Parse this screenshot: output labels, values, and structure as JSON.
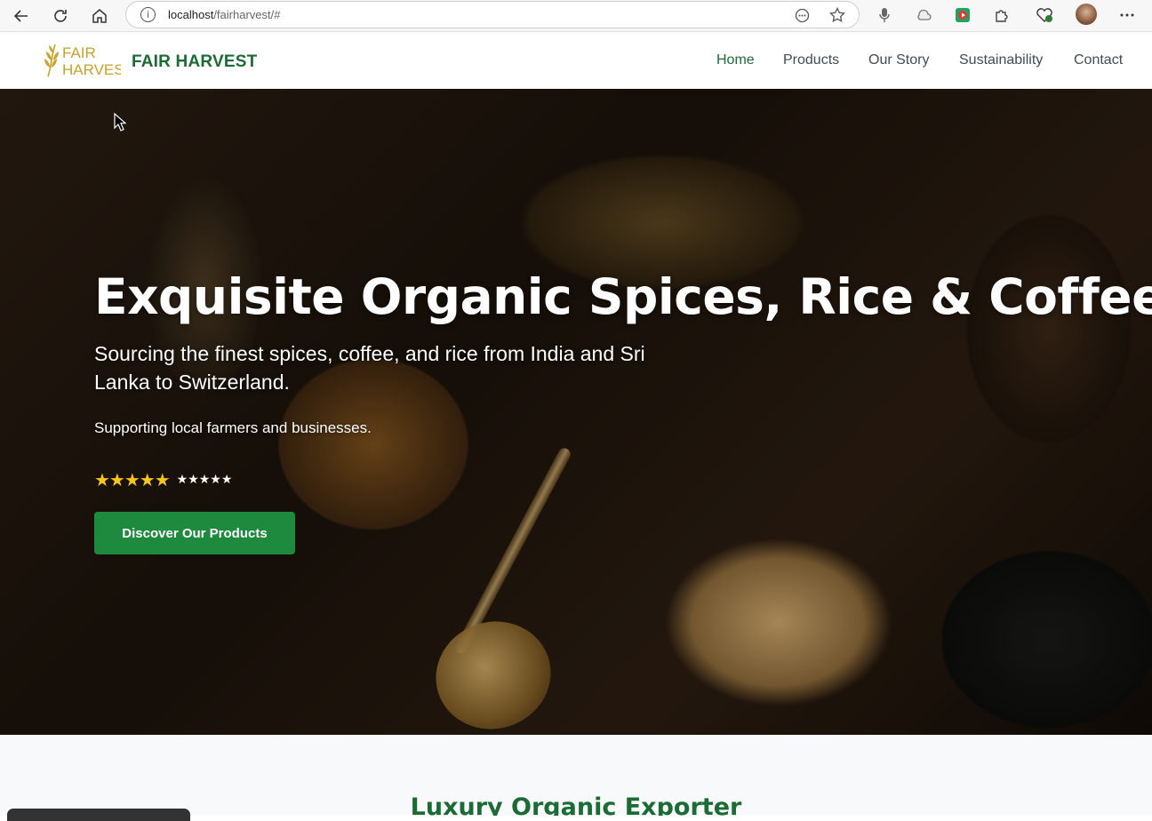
{
  "browser": {
    "url_host": "localhost",
    "url_path": "/fairharvest/#",
    "nav_back_icon": "back-arrow-icon",
    "nav_reload_icon": "reload-icon",
    "nav_home_icon": "home-icon"
  },
  "site": {
    "logo_text_top": "FAIR",
    "logo_text_bottom": "HARVEST",
    "brand": "FAIR HARVEST",
    "menu": [
      "Home",
      "Products",
      "Our Story",
      "Sustainability",
      "Contact"
    ],
    "active_menu": "Home",
    "brand_color": "#1b6b35",
    "accent_color": "#1e8a3e"
  },
  "hero": {
    "title": "Exquisite Organic Spices, Rice & Coffee",
    "subtitle": "Sourcing the finest spices, coffee, and rice from India and Sri Lanka to Switzerland.",
    "support": "Supporting local farmers and businesses.",
    "rating_stars_large": "★★★★★",
    "rating_stars_small": "★★★★★",
    "cta_label": "Discover Our Products"
  },
  "section": {
    "title": "Luxury Organic Exporter"
  }
}
